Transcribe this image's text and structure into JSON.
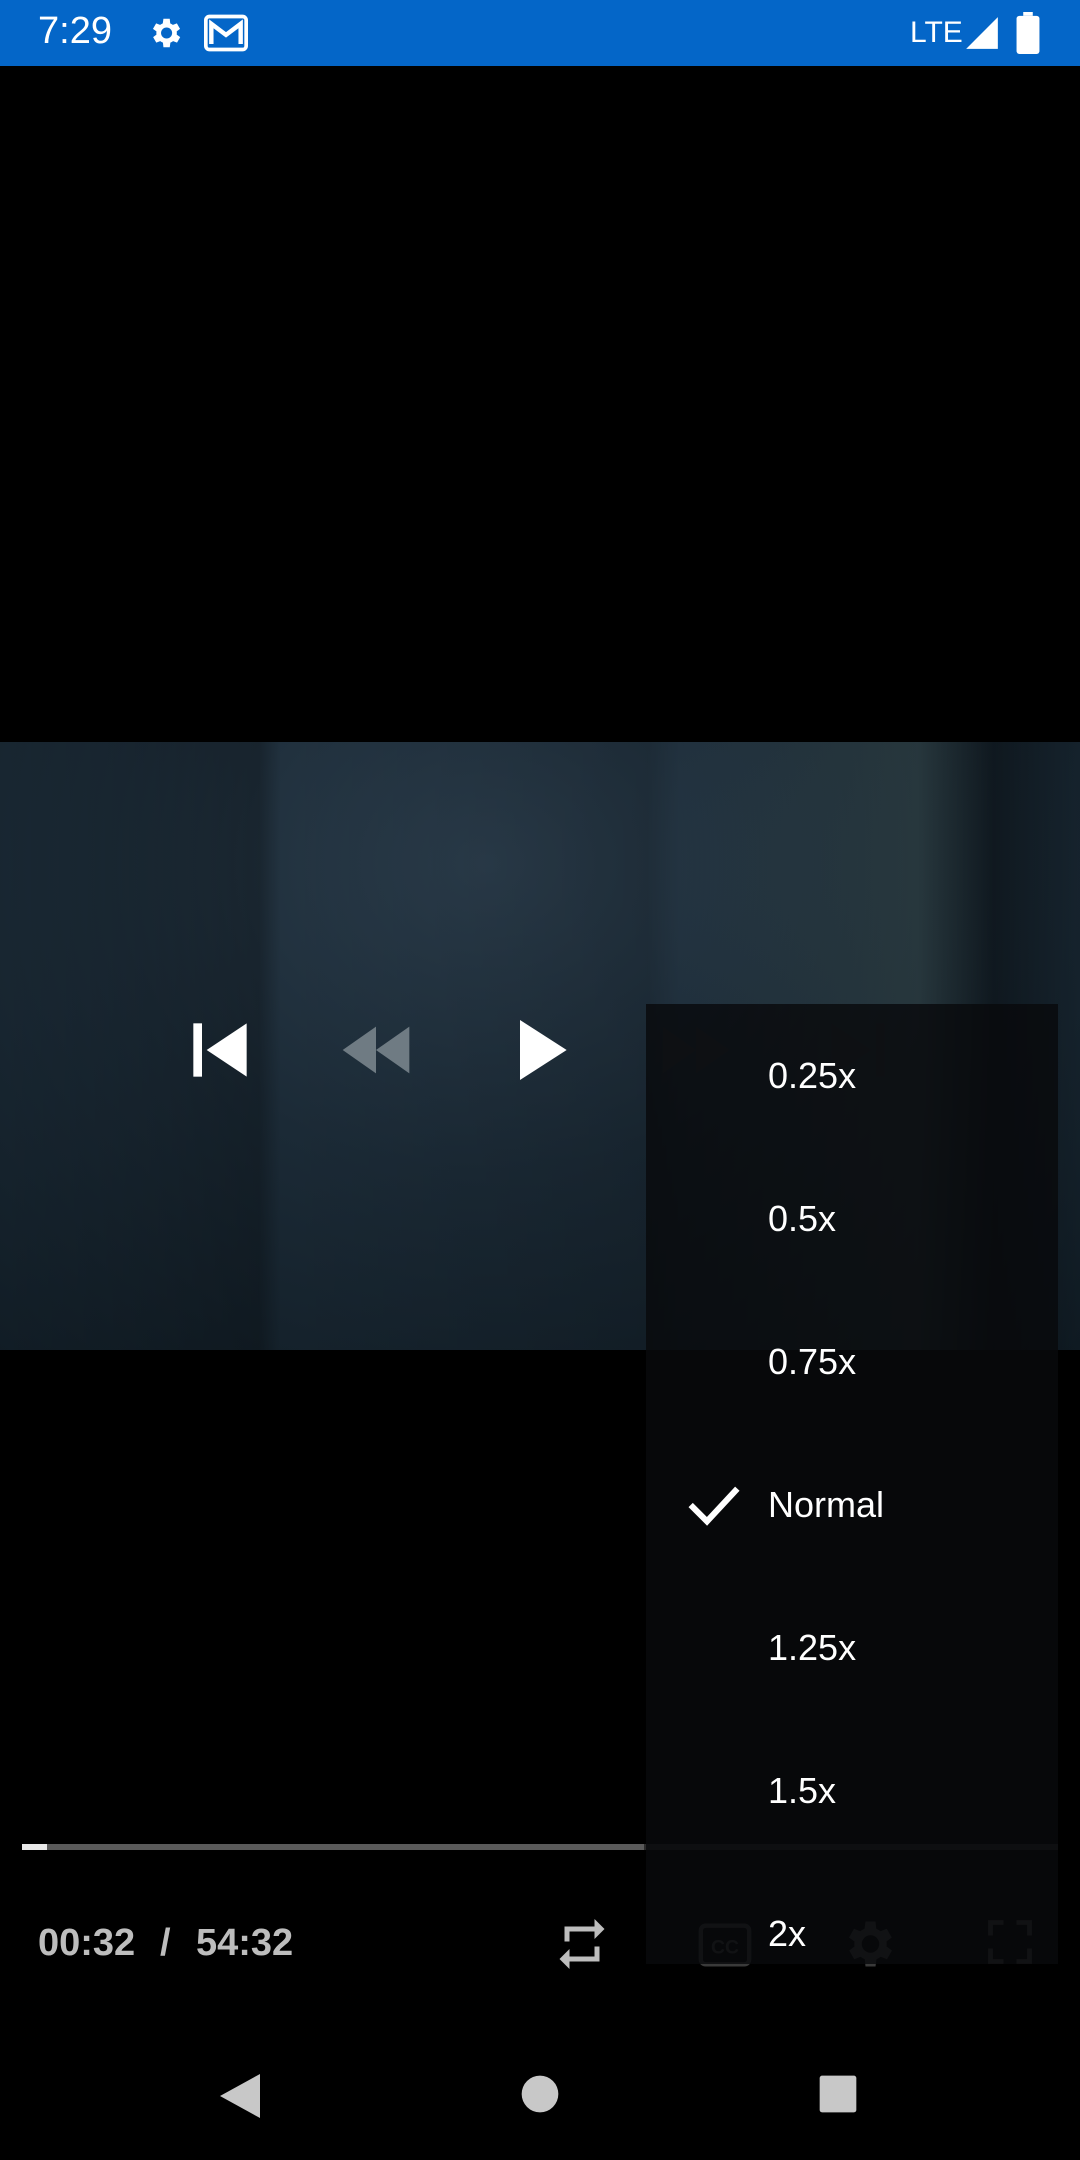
{
  "status_bar": {
    "time": "7:29",
    "network": "LTE",
    "icons": [
      "gear-icon",
      "mail-icon",
      "signal-icon",
      "battery-icon"
    ],
    "background": "#0466c8"
  },
  "player": {
    "controls": [
      "skip-previous-icon",
      "rewind-icon",
      "play-icon",
      "fast-forward-icon",
      "skip-next-icon"
    ],
    "progress": {
      "played_fraction": 0.024,
      "buffered_fraction": 0.6
    },
    "time_current": "00:32",
    "time_separator": "/",
    "time_total": "54:32",
    "bottom_icons": [
      "repeat-icon",
      "closed-captions-icon",
      "settings-icon",
      "fullscreen-icon"
    ]
  },
  "speed_menu": {
    "options": [
      "0.25x",
      "0.5x",
      "0.75x",
      "Normal",
      "1.25x",
      "1.5x",
      "2x"
    ],
    "selected": "Normal"
  },
  "nav_bar": {
    "icons": [
      "back-icon",
      "home-icon",
      "recents-icon"
    ]
  }
}
